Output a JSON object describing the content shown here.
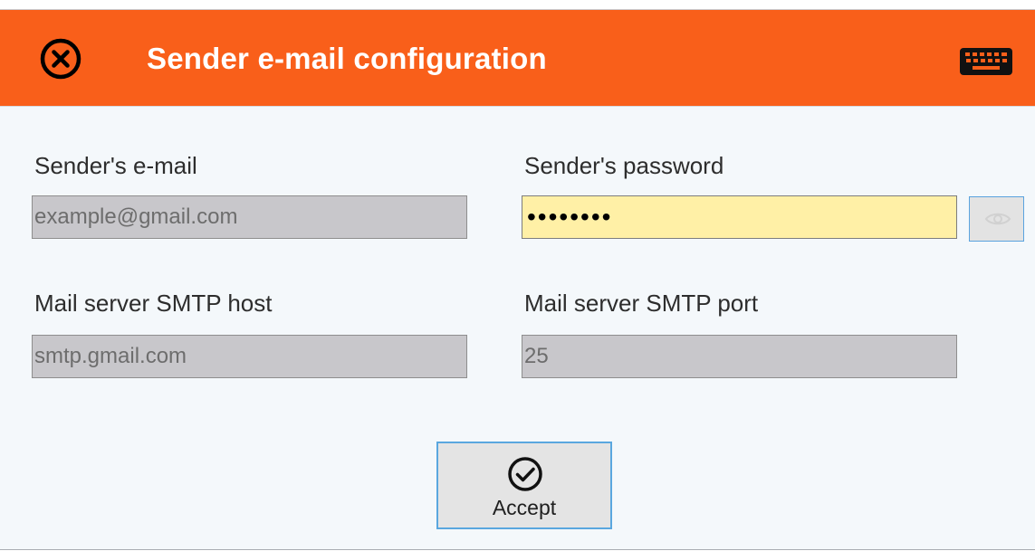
{
  "dialog": {
    "title": "Sender e-mail configuration",
    "header_color": "#f95f1a",
    "close_icon": "close-circle-icon",
    "keyboard_icon": "keyboard-icon"
  },
  "form": {
    "email": {
      "label": "Sender's e-mail",
      "value": "example@gmail.com"
    },
    "password": {
      "label": "Sender's password",
      "value": "••••••••",
      "reveal_icon": "eye-icon"
    },
    "smtp_host": {
      "label": "Mail server SMTP host",
      "value": "smtp.gmail.com"
    },
    "smtp_port": {
      "label": "Mail server SMTP port",
      "value": "25"
    }
  },
  "actions": {
    "accept_label": "Accept",
    "accept_icon": "checkmark-circle-icon"
  }
}
